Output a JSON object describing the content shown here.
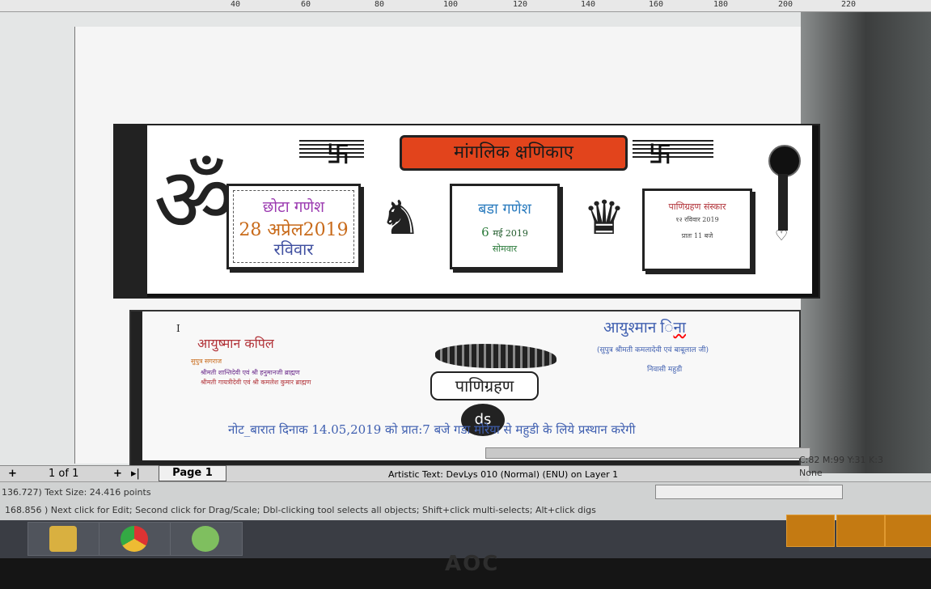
{
  "ruler": {
    "ticks": [
      "40",
      "60",
      "80",
      "100",
      "120",
      "140",
      "160",
      "180",
      "200",
      "220"
    ]
  },
  "card1": {
    "banner": "मांगलिक क्षणिकाए",
    "box1": {
      "title": "छोटा गणेश",
      "date": "28 अप्रेल2019",
      "day": "रविवार"
    },
    "box2": {
      "title": "बडा गणेश",
      "date_num": "6",
      "date_rest": "मई 2019",
      "day": "सोमवार"
    },
    "box3": {
      "title": "पाणिग्रहण संस्कार",
      "line2": "१२  रविवार 2019",
      "line3": "प्रातः 11    बजे"
    }
  },
  "card2": {
    "left_name": "आयुष्मान कपिल",
    "left_sub": "सुपुत्र सगराज",
    "left_line1": "श्रीमती शान्तिदेवी एवं श्री हनुमानजी ब्राह्मण",
    "left_line2": "श्रीमती गायत्रीदेवी एवं श्री कमलेश कुमार ब्राह्मण",
    "marker": "I",
    "right_name": "आयुश्मान ",
    "right_name2": "िना",
    "right_line1": "(सुपुत्र श्रीमती कमलादेवी एवं बाबूलाल जी)",
    "right_line2": "निवासी महुडी",
    "center_title": "पाणिग्रहण",
    "seal": "ds",
    "note": "नोट_बारात दिनाक 14.05,2019 को प्रात:7 बजे गडा मोरेया से महुडी के लिये प्रस्थान करेगी"
  },
  "pagebar": {
    "page_count": "1 of 1",
    "page_tab": "Page 1",
    "layer_info": "Artistic Text: DevLys 010 (Normal) (ENU) on Layer 1"
  },
  "status": {
    "coords1": "136.727)  Text Size: 24.416 points",
    "coords2": "168.856 )    Next click for Edit; Second click for Drag/Scale; Dbl-clicking tool selects all objects; Shift+click multi-selects; Alt+click digs",
    "color_info": "C:82 M:99 Y:31 K:3",
    "outline": "None"
  },
  "monitor": {
    "brand": "AOC"
  },
  "colors": {
    "banner": "#e2441c",
    "box1_title": "#9b3ab0",
    "box1_date": "#c86a1a",
    "box2_title": "#2d7dbf",
    "accent_blue": "#3f5fb0"
  }
}
